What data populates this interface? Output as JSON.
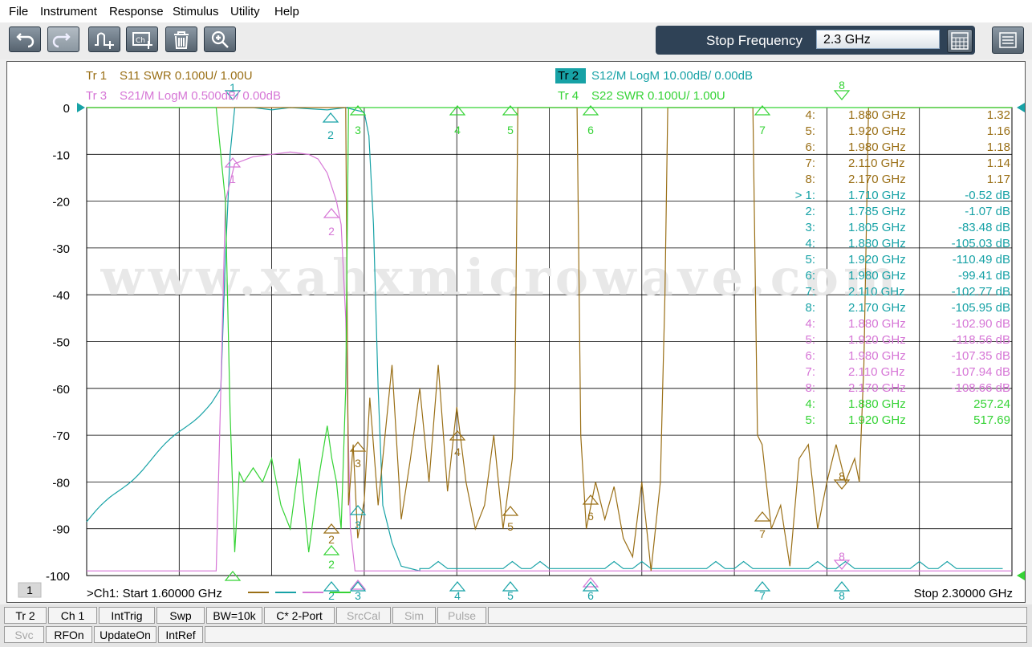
{
  "menu": [
    "File",
    "Instrument",
    "Response",
    "Stimulus",
    "Utility",
    "Help"
  ],
  "toolbar": {
    "buttons": [
      {
        "name": "undo-icon",
        "enabled": true
      },
      {
        "name": "redo-icon",
        "enabled": false
      },
      {
        "name": "add-marker-icon",
        "enabled": true
      },
      {
        "name": "add-channel-icon",
        "enabled": true
      },
      {
        "name": "trash-icon",
        "enabled": true
      },
      {
        "name": "zoom-icon",
        "enabled": true
      }
    ],
    "stop_frequency_label": "Stop Frequency",
    "stop_frequency_value": "2.3 GHz",
    "keypad_icon": "keypad-icon",
    "menu_icon": "hamburger-menu-icon"
  },
  "colors": {
    "tr1": "#9a6f16",
    "tr2": "#17a2a6",
    "tr3": "#d676d6",
    "tr4": "#35d335",
    "active_bg": "#17a2a6"
  },
  "traces": [
    {
      "id": "Tr 1",
      "desc": "S11 SWR 0.100U/  1.00U"
    },
    {
      "id": "Tr 2",
      "desc": "S12/M LogM 10.00dB/  0.00dB"
    },
    {
      "id": "Tr 3",
      "desc": "S21/M LogM 0.500dB/  0.00dB"
    },
    {
      "id": "Tr 4",
      "desc": "S22 SWR 0.100U/  1.00U"
    }
  ],
  "watermark": "www.xahxmicrowave.com",
  "y_ticks": [
    "0",
    "-10",
    "-20",
    "-30",
    "-40",
    "-50",
    "-60",
    "-70",
    "-80",
    "-90",
    "-100"
  ],
  "channel_number": "1",
  "start_label": ">Ch1:  Start  1.60000 GHz",
  "stop_label": "Stop  2.30000 GHz",
  "marker_table": [
    {
      "n": "4:",
      "f": "1.880  GHz",
      "v": "1.32",
      "t": 1
    },
    {
      "n": "5:",
      "f": "1.920  GHz",
      "v": "1.16",
      "t": 1
    },
    {
      "n": "6:",
      "f": "1.980  GHz",
      "v": "1.18",
      "t": 1
    },
    {
      "n": "7:",
      "f": "2.110  GHz",
      "v": "1.14",
      "t": 1
    },
    {
      "n": "8:",
      "f": "2.170  GHz",
      "v": "1.17",
      "t": 1
    },
    {
      "n": "> 1:",
      "f": "1.710  GHz",
      "v": "-0.52 dB",
      "t": 2
    },
    {
      "n": "2:",
      "f": "1.785  GHz",
      "v": "-1.07 dB",
      "t": 2
    },
    {
      "n": "3:",
      "f": "1.805  GHz",
      "v": "-83.48 dB",
      "t": 2
    },
    {
      "n": "4:",
      "f": "1.880  GHz",
      "v": "-105.03 dB",
      "t": 2
    },
    {
      "n": "5:",
      "f": "1.920  GHz",
      "v": "-110.49 dB",
      "t": 2
    },
    {
      "n": "6:",
      "f": "1.980  GHz",
      "v": "-99.41 dB",
      "t": 2
    },
    {
      "n": "7:",
      "f": "2.110  GHz",
      "v": "-102.77 dB",
      "t": 2
    },
    {
      "n": "8:",
      "f": "2.170  GHz",
      "v": "-105.95 dB",
      "t": 2
    },
    {
      "n": "4:",
      "f": "1.880  GHz",
      "v": "-102.90 dB",
      "t": 3
    },
    {
      "n": "5:",
      "f": "1.920  GHz",
      "v": "-118.56 dB",
      "t": 3
    },
    {
      "n": "6:",
      "f": "1.980  GHz",
      "v": "-107.35 dB",
      "t": 3
    },
    {
      "n": "7:",
      "f": "2.110  GHz",
      "v": "-107.94 dB",
      "t": 3
    },
    {
      "n": "8:",
      "f": "2.170  GHz",
      "v": "-108.66 dB",
      "t": 3
    },
    {
      "n": "4:",
      "f": "1.880  GHz",
      "v": "257.24",
      "t": 4
    },
    {
      "n": "5:",
      "f": "1.920  GHz",
      "v": "517.69",
      "t": 4
    }
  ],
  "bottom_markers": [
    "2",
    "3",
    "4",
    "5",
    "6",
    "7",
    "8"
  ],
  "status_row1": [
    {
      "label": "Tr 2",
      "dim": false
    },
    {
      "label": "Ch 1",
      "dim": false
    },
    {
      "label": "IntTrig",
      "dim": false
    },
    {
      "label": "Swp",
      "dim": false
    },
    {
      "label": "BW=10k",
      "dim": false
    },
    {
      "label": "C* 2-Port",
      "dim": false
    },
    {
      "label": "SrcCal",
      "dim": true
    },
    {
      "label": "Sim",
      "dim": true
    },
    {
      "label": "Pulse",
      "dim": true
    }
  ],
  "status_row2": [
    {
      "label": "Svc",
      "dim": true
    },
    {
      "label": "RFOn",
      "dim": false
    },
    {
      "label": "UpdateOn",
      "dim": false
    },
    {
      "label": "IntRef",
      "dim": false
    }
  ]
}
